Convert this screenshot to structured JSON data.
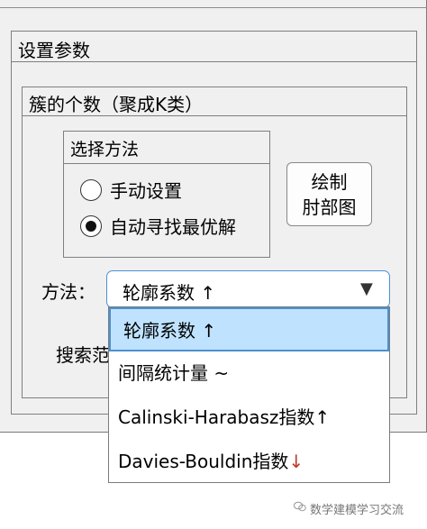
{
  "settings_panel": {
    "title": "设置参数"
  },
  "cluster_panel": {
    "title": "簇的个数（聚成K类）"
  },
  "method_group": {
    "title": "选择方法",
    "options": [
      {
        "label": "手动设置",
        "selected": false
      },
      {
        "label": "自动寻找最优解",
        "selected": true
      }
    ]
  },
  "draw_button": {
    "line1": "绘制",
    "line2": "肘部图"
  },
  "method_select": {
    "label": "方法：",
    "value": "轮廓系数 ↑",
    "options": [
      {
        "text": "轮廓系数 ↑"
      },
      {
        "text": "间隔统计量 ~"
      },
      {
        "text": "Calinski-Harabasz指数↑"
      },
      {
        "text": "Davies-Bouldin指数",
        "arrow": "↓"
      }
    ]
  },
  "search_label": "搜索范",
  "watermark": "数学建模学习交流",
  "icons": {
    "dropdown": "chevron-down-icon",
    "watermark": "wechat-icon"
  },
  "colors": {
    "selected_option": "#bfe3ff",
    "focus_border": "#4a90d9"
  }
}
